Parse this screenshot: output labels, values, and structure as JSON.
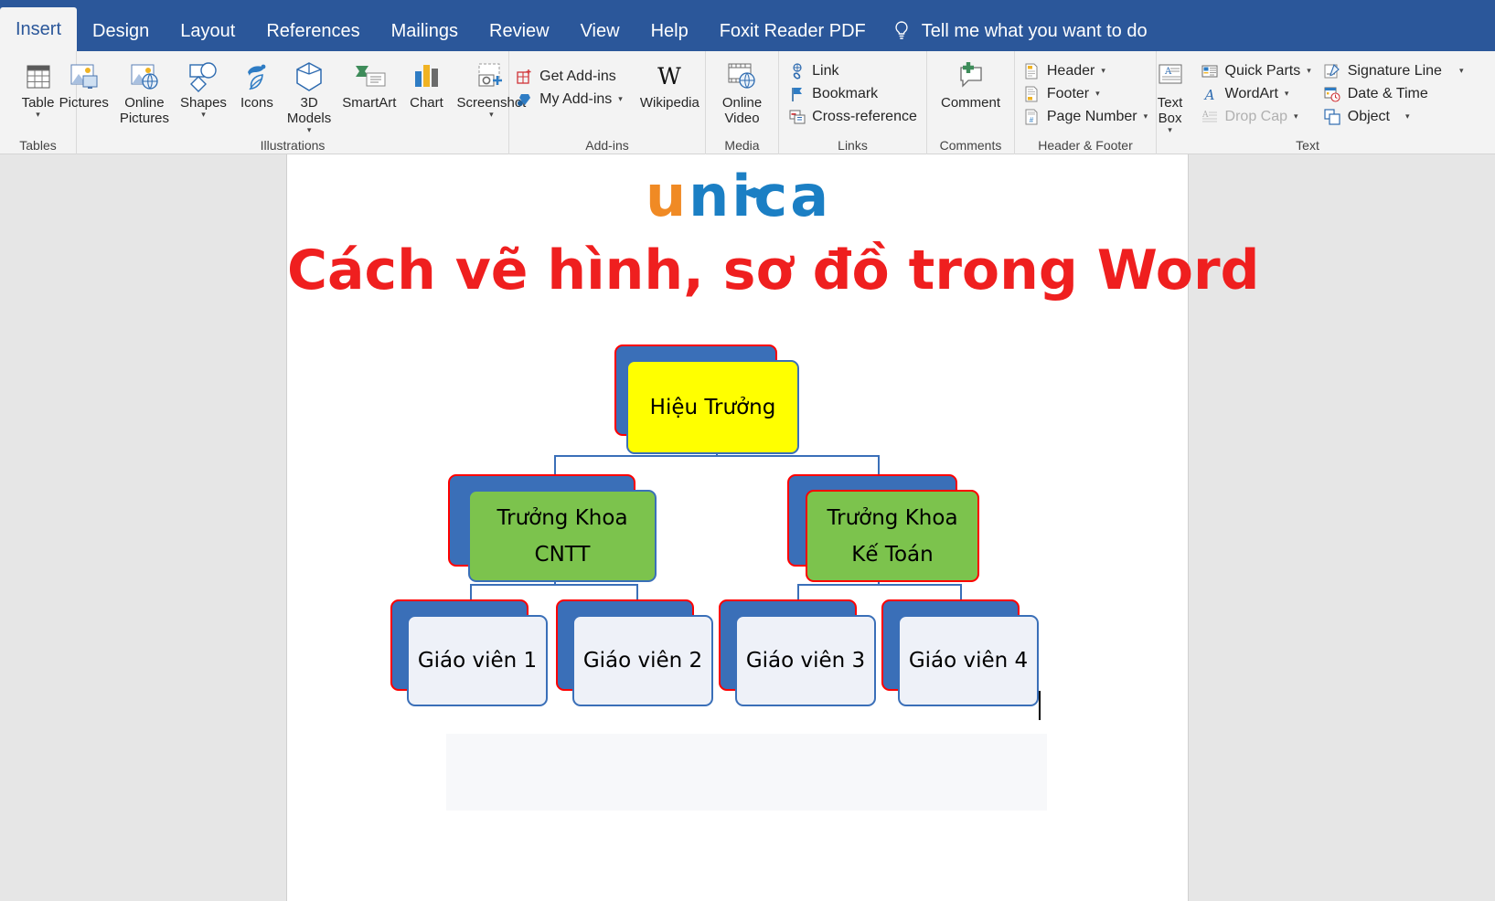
{
  "ribbon": {
    "tabs": [
      {
        "label": "Insert",
        "active": true
      },
      {
        "label": "Design",
        "active": false
      },
      {
        "label": "Layout",
        "active": false
      },
      {
        "label": "References",
        "active": false
      },
      {
        "label": "Mailings",
        "active": false
      },
      {
        "label": "Review",
        "active": false
      },
      {
        "label": "View",
        "active": false
      },
      {
        "label": "Help",
        "active": false
      },
      {
        "label": "Foxit Reader PDF",
        "active": false
      }
    ],
    "tellme": {
      "label": "Tell me what you want to do",
      "icon": "lightbulb-icon"
    },
    "groups": [
      {
        "name": "Tables",
        "label": "Tables",
        "items": [
          {
            "label": "Table",
            "icon": "table-icon",
            "caret": true
          }
        ]
      },
      {
        "name": "Illustrations",
        "label": "Illustrations",
        "items": [
          {
            "label": "Pictures",
            "icon": "pictures-icon",
            "caret": false
          },
          {
            "label": "Online\nPictures",
            "icon": "online-pictures-icon",
            "caret": false
          },
          {
            "label": "Shapes",
            "icon": "shapes-icon",
            "caret": true
          },
          {
            "label": "Icons",
            "icon": "icons-icon",
            "caret": false
          },
          {
            "label": "3D\nModels",
            "icon": "3d-models-icon",
            "caret": true
          },
          {
            "label": "SmartArt",
            "icon": "smartart-icon",
            "caret": false
          },
          {
            "label": "Chart",
            "icon": "chart-icon",
            "caret": false
          },
          {
            "label": "Screenshot",
            "icon": "screenshot-icon",
            "caret": true
          }
        ]
      },
      {
        "name": "Add-ins",
        "label": "Add-ins",
        "small": [
          {
            "label": "Get Add-ins",
            "icon": "get-addins-icon"
          },
          {
            "label": "My Add-ins",
            "icon": "my-addins-icon",
            "caret": true
          }
        ],
        "items": [
          {
            "label": "Wikipedia",
            "icon": "wikipedia-icon",
            "caret": false
          }
        ]
      },
      {
        "name": "Media",
        "label": "Media",
        "items": [
          {
            "label": "Online\nVideo",
            "icon": "online-video-icon",
            "caret": false
          }
        ]
      },
      {
        "name": "Links",
        "label": "Links",
        "small": [
          {
            "label": "Link",
            "icon": "link-icon"
          },
          {
            "label": "Bookmark",
            "icon": "bookmark-icon"
          },
          {
            "label": "Cross-reference",
            "icon": "cross-reference-icon"
          }
        ]
      },
      {
        "name": "Comments",
        "label": "Comments",
        "items": [
          {
            "label": "Comment",
            "icon": "comment-icon",
            "caret": false
          }
        ]
      },
      {
        "name": "HeaderFooter",
        "label": "Header & Footer",
        "small": [
          {
            "label": "Header",
            "icon": "header-icon",
            "caret": true
          },
          {
            "label": "Footer",
            "icon": "footer-icon",
            "caret": true
          },
          {
            "label": "Page Number",
            "icon": "page-number-icon",
            "caret": true
          }
        ]
      },
      {
        "name": "Text",
        "label": "Text",
        "items": [
          {
            "label": "Text\nBox",
            "icon": "text-box-icon",
            "caret": true
          }
        ],
        "small": [
          {
            "label": "Quick Parts",
            "icon": "quick-parts-icon",
            "caret": true
          },
          {
            "label": "WordArt",
            "icon": "wordart-icon",
            "caret": true
          },
          {
            "label": "Drop Cap",
            "icon": "drop-cap-icon",
            "caret": true,
            "disabled": true
          }
        ],
        "small2": [
          {
            "label": "Signature Line",
            "icon": "signature-line-icon",
            "caret": true
          },
          {
            "label": "Date & Time",
            "icon": "date-time-icon"
          },
          {
            "label": "Object",
            "icon": "object-icon",
            "caret": true
          }
        ]
      }
    ]
  },
  "document": {
    "logo": {
      "part1": "u",
      "part2": "nica",
      "color1": "#f08a24",
      "color2": "#1b7fc4",
      "cap": "graduation-cap-icon"
    },
    "title": "Cách vẽ hình, sơ đồ trong Word",
    "title_color": "#ef1f1f",
    "orgchart": {
      "root": {
        "text": "Hiệu Trưởng",
        "fill": "#ffff00",
        "border": "#3a6fb8",
        "shadow_fill": "#3a6fb8",
        "shadow_border": "#ff0000"
      },
      "level2": [
        {
          "text_line1": "Trưởng Khoa",
          "text_line2": "CNTT",
          "fill": "#7cc34d",
          "border": "#3a6fb8",
          "shadow_fill": "#3a6fb8",
          "shadow_border": "#ff0000"
        },
        {
          "text_line1": "Trưởng Khoa",
          "text_line2": "Kế Toán",
          "fill": "#7cc34d",
          "border": "#ff0000",
          "shadow_fill": "#3a6fb8",
          "shadow_border": "#ff0000"
        }
      ],
      "level3": [
        {
          "text": "Giáo viên 1",
          "fill": "#eef1f8",
          "border": "#3a6fb8",
          "shadow_fill": "#3a6fb8",
          "shadow_border": "#ff0000"
        },
        {
          "text": "Giáo viên 2",
          "fill": "#eef1f8",
          "border": "#3a6fb8",
          "shadow_fill": "#3a6fb8",
          "shadow_border": "#ff0000"
        },
        {
          "text": "Giáo viên 3",
          "fill": "#eef1f8",
          "border": "#3a6fb8",
          "shadow_fill": "#3a6fb8",
          "shadow_border": "#ff0000"
        },
        {
          "text": "Giáo viên 4",
          "fill": "#eef1f8",
          "border": "#3a6fb8",
          "shadow_fill": "#3a6fb8",
          "shadow_border": "#ff0000"
        }
      ],
      "connector_color": "#3a6fb8"
    }
  }
}
